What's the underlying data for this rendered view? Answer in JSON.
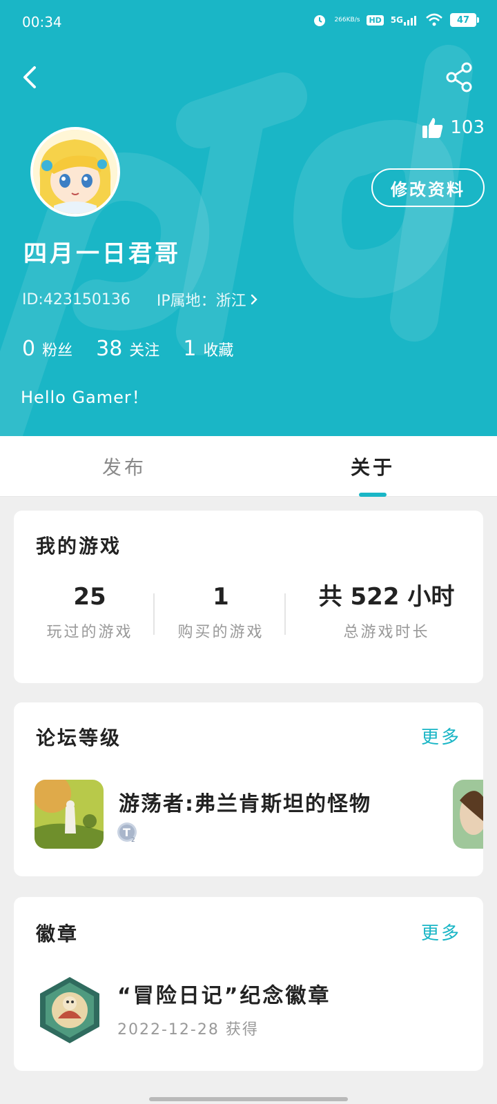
{
  "status_bar": {
    "time": "00:34",
    "net_speed_value": "266",
    "net_speed_unit": "KB/s",
    "hd": "HD",
    "signal": "5G",
    "battery": "47"
  },
  "profile": {
    "likes": "103",
    "edit_label": "修改资料",
    "nickname": "四月一日君哥",
    "id_text": "ID:423150136",
    "ip_text": "IP属地：浙江",
    "stats": [
      {
        "num": "0",
        "label": "粉丝"
      },
      {
        "num": "38",
        "label": "关注"
      },
      {
        "num": "1",
        "label": "收藏"
      }
    ],
    "bio": "Hello Gamer！"
  },
  "tabs": {
    "publish": "发布",
    "about": "关于"
  },
  "games_card": {
    "title": "我的游戏",
    "played_value": "25",
    "played_label": "玩过的游戏",
    "bought_value": "1",
    "bought_label": "购买的游戏",
    "hours_value": "共 522 小时",
    "hours_label": "总游戏时长"
  },
  "forum_card": {
    "title": "论坛等级",
    "more": "更多",
    "game_name": "游荡者:弗兰肯斯坦的怪物"
  },
  "medal_card": {
    "title": "徽章",
    "more": "更多",
    "medal_name": "“冒险日记”纪念徽章",
    "medal_date": "2022-12-28 获得"
  },
  "colors": {
    "brand": "#1ab6c6",
    "text_dark": "#222222",
    "text_muted": "#999999"
  }
}
